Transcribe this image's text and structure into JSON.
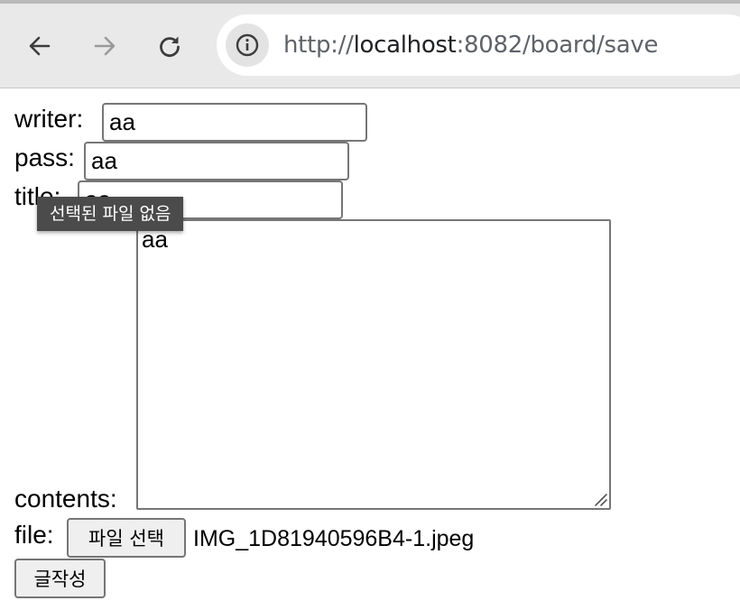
{
  "browser": {
    "url_scheme": "http://",
    "url_host": "localhost",
    "url_rest": ":8082/board/save"
  },
  "form": {
    "writer_label": "writer:",
    "writer_value": "aa",
    "pass_label": "pass:",
    "pass_value": "aa",
    "title_label": "title:",
    "title_value": "aa",
    "contents_label": "contents:",
    "contents_value": "aa",
    "file_label": "file:",
    "file_button": "파일 선택",
    "file_name": "IMG_1D81940596B4-1.jpeg",
    "submit_label": "글작성"
  },
  "tooltip": {
    "text": "선택된 파일 없음"
  },
  "colors": {
    "toolbar": "#e9e9e9",
    "tooltip_bg": "#4b4b4b",
    "field_border": "#767676"
  }
}
